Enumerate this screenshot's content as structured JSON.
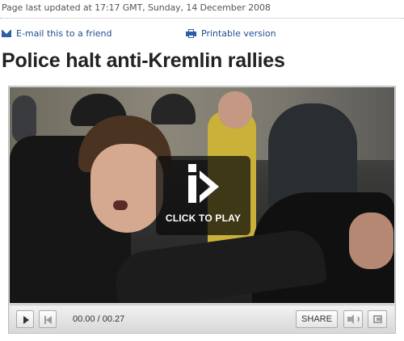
{
  "meta": {
    "updated": "Page last updated at 17:17 GMT, Sunday, 14 December 2008"
  },
  "tools": {
    "email_label": "E-mail this to a friend",
    "print_label": "Printable version"
  },
  "headline": "Police halt anti-Kremlin rallies",
  "player": {
    "overlay_label": "CLICK TO PLAY",
    "time": "00.00 / 00.27",
    "share_label": "SHARE"
  },
  "icons": {
    "email": "envelope-icon",
    "print": "printer-icon",
    "overlay": "click-to-play-logo",
    "play": "play-icon",
    "rewind": "rewind-icon",
    "volume": "volume-icon",
    "fullscreen": "fullscreen-icon"
  },
  "colors": {
    "link": "#1f4b8e",
    "icon_blue": "#2d5ea8",
    "headline": "#222222"
  }
}
